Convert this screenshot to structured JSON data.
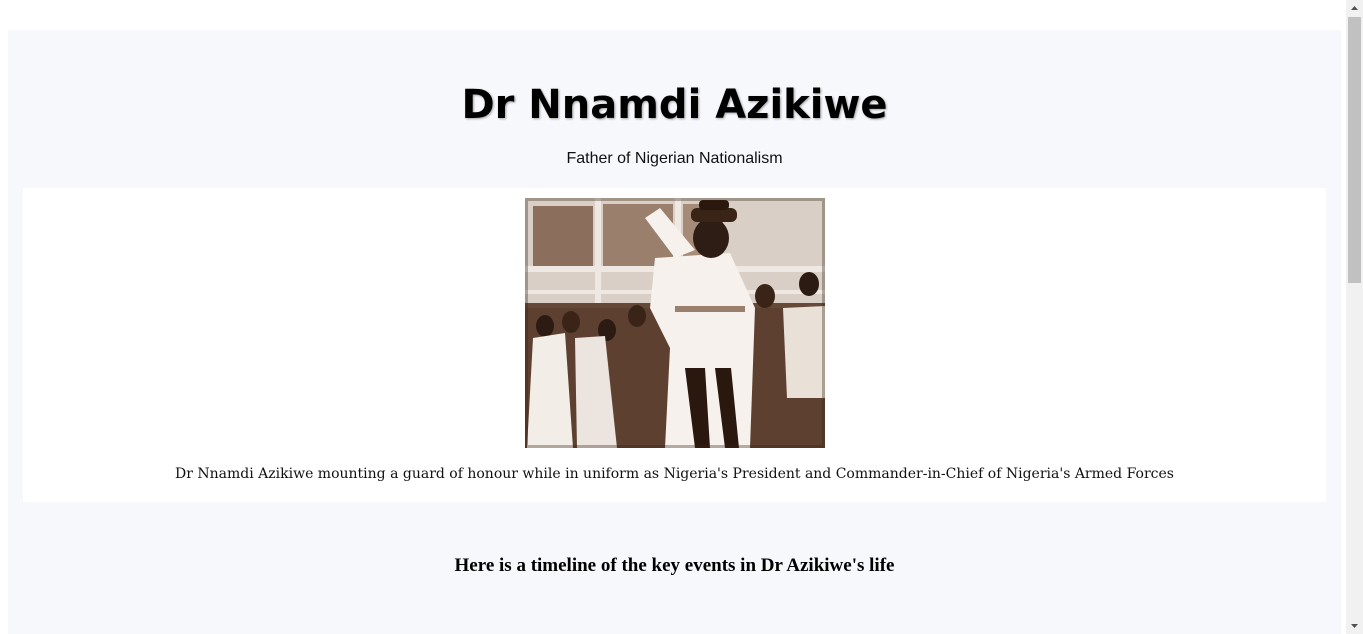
{
  "header": {
    "title": "Dr Nnamdi Azikiwe",
    "subtitle": "Father of Nigerian Nationalism"
  },
  "image_section": {
    "image_description": "Black and white photo of Dr Nnamdi Azikiwe in white military uniform saluting",
    "caption": "Dr Nnamdi Azikiwe mounting a guard of honour while in uniform as Nigeria's President and Commander-in-Chief of Nigeria's Armed Forces"
  },
  "timeline": {
    "heading": "Here is a timeline of the key events in Dr Azikiwe's life"
  },
  "scrollbar": {
    "up_icon": "triangle-up",
    "down_icon": "triangle-down"
  },
  "colors": {
    "page_background": "#f7f8fc",
    "image_card_background": "#ffffff",
    "scrollbar_track": "#f1f1f1",
    "scrollbar_thumb": "#c1c1c1"
  }
}
